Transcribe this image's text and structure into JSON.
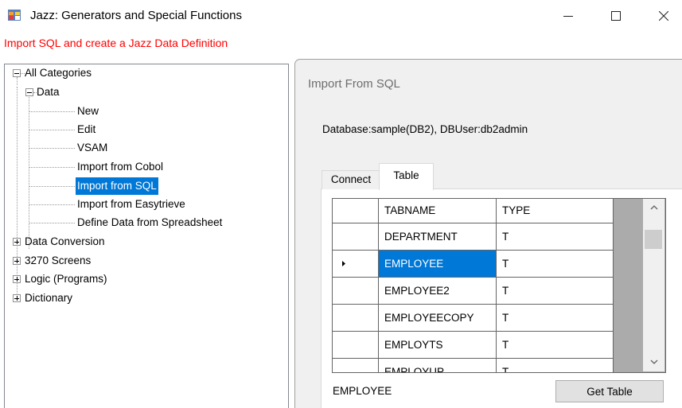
{
  "window": {
    "title": "Jazz: Generators and Special Functions",
    "controls": [
      "minimize-icon",
      "maximize-icon",
      "close-icon"
    ]
  },
  "subtitle": {
    "text": "Import SQL and create a Jazz Data Definition",
    "color": "#ff0000"
  },
  "tree": {
    "root": {
      "label": "All Categories",
      "expanded": true
    },
    "data_node": {
      "label": "Data",
      "expanded": true
    },
    "data_children": [
      "New",
      "Edit",
      "VSAM",
      "Import from Cobol",
      "Import from SQL",
      "Import from Easytrieve",
      "Define Data from Spreadsheet"
    ],
    "selected": "Import from SQL",
    "collapsed_nodes": [
      "Data Conversion",
      "3270 Screens",
      "Logic (Programs)",
      "Dictionary"
    ]
  },
  "panel": {
    "header": "Import From SQL",
    "db_info": "Database:sample(DB2), DBUser:db2admin",
    "tabs": [
      {
        "label": "Connect",
        "active": false
      },
      {
        "label": "Table",
        "active": true
      }
    ]
  },
  "grid": {
    "columns": [
      "TABNAME",
      "TYPE"
    ],
    "rows": [
      {
        "tabname": "DEPARTMENT",
        "type": "T",
        "current": false
      },
      {
        "tabname": "EMPLOYEE",
        "type": "T",
        "current": true
      },
      {
        "tabname": "EMPLOYEE2",
        "type": "T",
        "current": false
      },
      {
        "tabname": "EMPLOYEECOPY",
        "type": "T",
        "current": false
      },
      {
        "tabname": "EMPLOYTS",
        "type": "T",
        "current": false
      },
      {
        "tabname": "EMPLOYUP",
        "type": "T",
        "current": false
      }
    ],
    "selected_color": "#0078d7"
  },
  "selected_table": "EMPLOYEE",
  "get_table_button": "Get Table"
}
